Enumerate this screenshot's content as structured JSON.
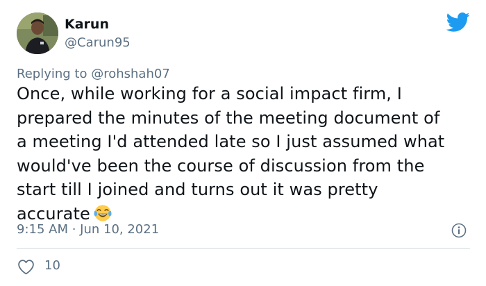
{
  "tweet": {
    "author": {
      "display_name": "Karun",
      "handle": "@Carun95"
    },
    "replying_prefix": "Replying to",
    "replying_to": "@rohshah07",
    "text_lines": [
      "Once, while working for a social impact firm, I",
      "prepared the minutes of the meeting document of",
      "a meeting I'd attended late so I just assumed what",
      "would've been the course of discussion from the",
      "start till I joined and turns out it was pretty",
      "accurate"
    ],
    "emoji": "face-with-tears-of-joy",
    "timestamp": "9:15 AM · Jun 10, 2021",
    "like_count": "10"
  },
  "icons": {
    "brand": "twitter-bird-icon",
    "info": "info-icon",
    "like": "heart-icon"
  },
  "colors": {
    "twitter_blue": "#1d9bf0",
    "secondary_text": "#5b7083",
    "primary_text": "#0f1419",
    "divider": "#cfd9de"
  }
}
